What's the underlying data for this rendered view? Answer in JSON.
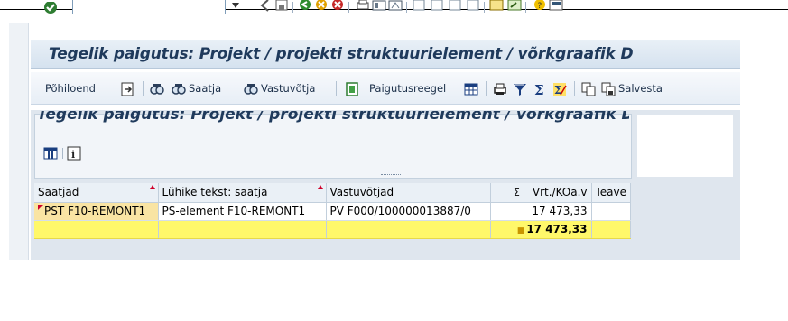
{
  "window": {
    "title": "Tegelik paigutus: Projekt / projekti struktuurielement / võrkgraafik D",
    "subtitle": "Tegelik paigutus: Projekt / projekti struktuurielement / võrkgraafik D"
  },
  "command_field": {
    "value": ""
  },
  "toolbar": {
    "items": [
      {
        "label": "Põhiloend",
        "icon": "list-icon"
      },
      {
        "label": "",
        "icon": "export-icon"
      },
      {
        "label": "",
        "icon": "binoculars-icon"
      },
      {
        "label": "Saatja",
        "icon": "binoculars-icon"
      },
      {
        "label": "Vastuvõtja",
        "icon": "binoculars-icon"
      },
      {
        "label": "Paigutusreegel",
        "icon": "rule-icon"
      },
      {
        "label": "",
        "icon": "grid-icon"
      },
      {
        "label": "",
        "icon": "print-icon"
      },
      {
        "label": "",
        "icon": "filter-icon"
      },
      {
        "label": "",
        "icon": "sum-icon"
      },
      {
        "label": "",
        "icon": "subtotal-icon"
      },
      {
        "label": "",
        "icon": "copy-icon"
      },
      {
        "label": "Salvesta",
        "icon": "save-layout-icon"
      }
    ]
  },
  "grid": {
    "columns": [
      "Saatjad",
      "Lühike tekst: saatja",
      "Vastuvõtjad",
      "Vrt./KOa.v",
      "Teave"
    ],
    "sum_symbol": "Σ",
    "rows": [
      {
        "sender": "PST F10-REMONT1",
        "short_text": "PS-element F10-REMONT1",
        "receiver": "PV F000/100000013887/0",
        "value": "17 473,33",
        "info": ""
      }
    ],
    "total": {
      "value": "17 473,33"
    }
  },
  "colors": {
    "title_text": "#1f3a5c",
    "total_row": "#fff86a",
    "key_cell": "#f9e4a3",
    "sort_marker": "#d0002a"
  }
}
